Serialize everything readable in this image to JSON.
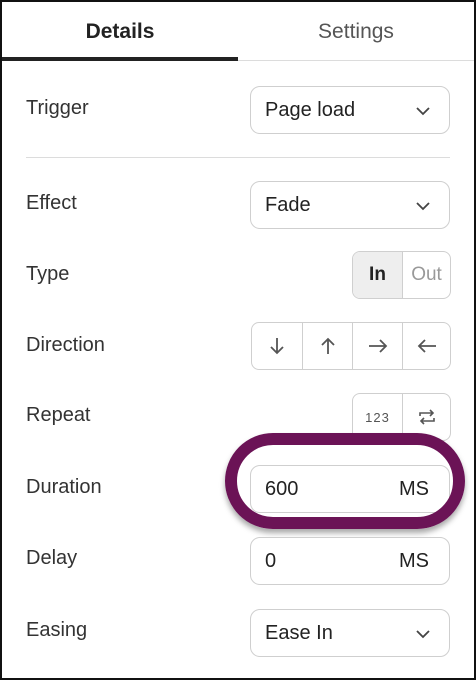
{
  "tabs": [
    {
      "label": "Details",
      "active": true
    },
    {
      "label": "Settings",
      "active": false
    }
  ],
  "fields": {
    "trigger": {
      "label": "Trigger",
      "value": "Page load"
    },
    "effect": {
      "label": "Effect",
      "value": "Fade"
    },
    "type": {
      "label": "Type",
      "options": [
        "In",
        "Out"
      ],
      "selected": "In"
    },
    "direction": {
      "label": "Direction",
      "options": [
        "down-arrow-icon",
        "up-arrow-icon",
        "right-arrow-icon",
        "left-arrow-icon"
      ]
    },
    "repeat": {
      "label": "Repeat",
      "options": [
        "123",
        "repeat-icon"
      ]
    },
    "duration": {
      "label": "Duration",
      "value": "600",
      "unit": "MS"
    },
    "delay": {
      "label": "Delay",
      "value": "0",
      "unit": "MS"
    },
    "easing": {
      "label": "Easing",
      "value": "Ease In"
    }
  },
  "colors": {
    "highlight": "#6b1356",
    "active_tab": "#222222"
  }
}
